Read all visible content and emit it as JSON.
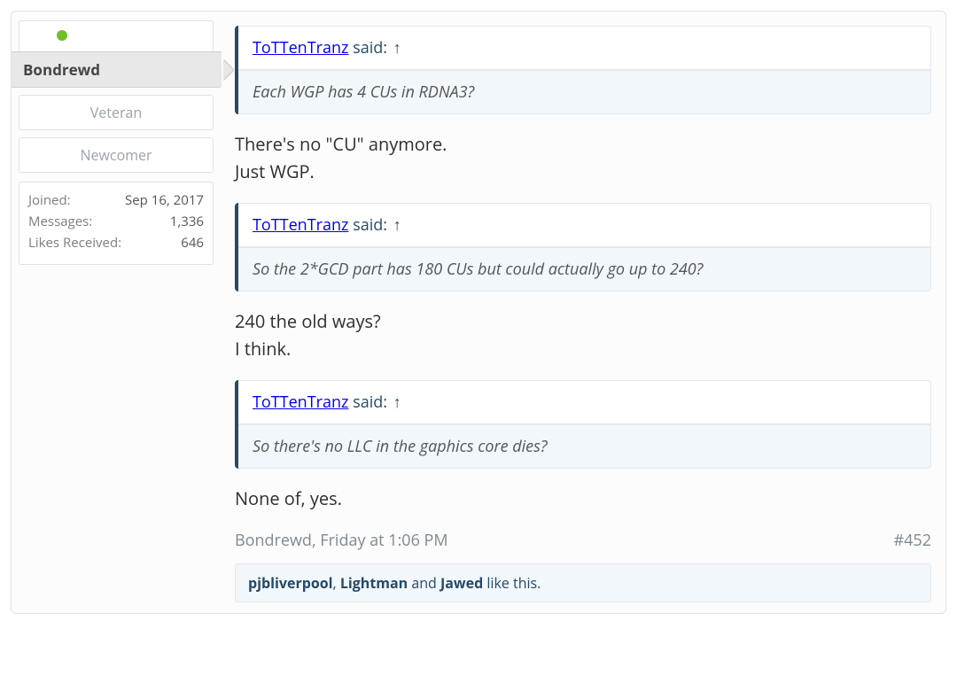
{
  "user": {
    "name": "Bondrewd",
    "title1": "Veteran",
    "title2": "Newcomer",
    "stats": {
      "joined_label": "Joined:",
      "joined_value": "Sep 16, 2017",
      "messages_label": "Messages:",
      "messages_value": "1,336",
      "likes_label": "Likes Received:",
      "likes_value": "646"
    }
  },
  "quotes": [
    {
      "author": "ToTTenTranz",
      "said": " said: ",
      "arrow": "↑",
      "body": "Each WGP has 4 CUs in RDNA3?"
    },
    {
      "author": "ToTTenTranz",
      "said": " said: ",
      "arrow": "↑",
      "body": "So the 2*GCD part has 180 CUs but could actually go up to 240?"
    },
    {
      "author": "ToTTenTranz",
      "said": " said: ",
      "arrow": "↑",
      "body": "So there's no LLC in the gaphics core dies?"
    }
  ],
  "replies": {
    "r1a": "There's no \"CU\" anymore.",
    "r1b": "Just WGP.",
    "r2a": "240 the old ways?",
    "r2b": "I think.",
    "r3": "None of, yes."
  },
  "meta": {
    "author": "Bondrewd",
    "sep": ", ",
    "time": "Friday at 1:06 PM",
    "permalink": "#452"
  },
  "likes": {
    "u1": "pjbliverpool",
    "c1": ", ",
    "u2": "Lightman",
    "c2": " and ",
    "u3": "Jawed",
    "tail": " like this."
  }
}
